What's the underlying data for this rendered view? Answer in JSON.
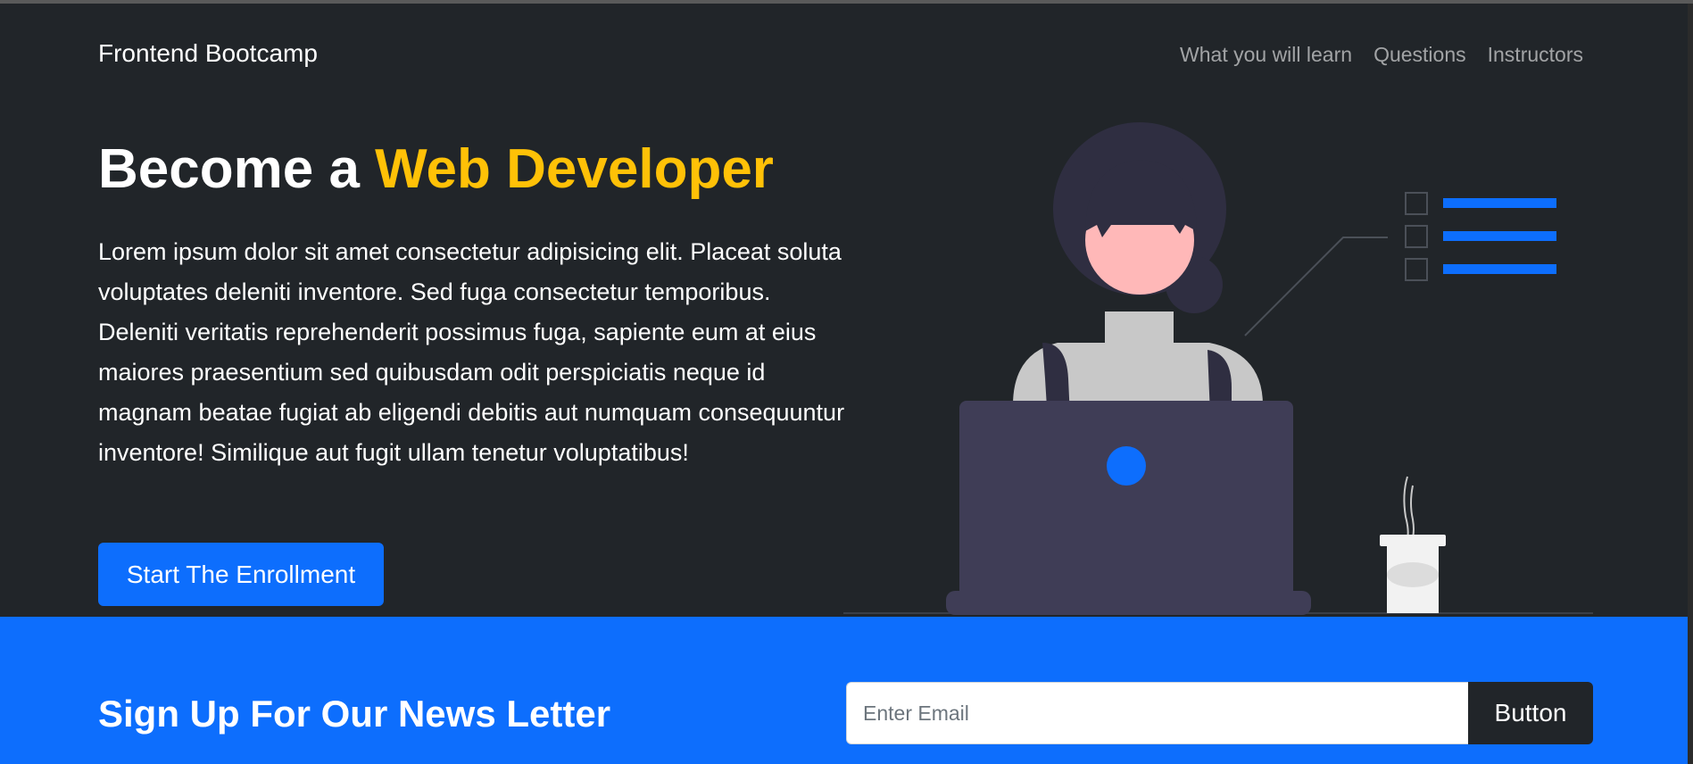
{
  "navbar": {
    "brand": "Frontend Bootcamp",
    "links": [
      "What you will learn",
      "Questions",
      "Instructors"
    ]
  },
  "hero": {
    "headline_prefix": "Become a ",
    "headline_accent": "Web Developer",
    "paragraph": "Lorem ipsum dolor sit amet consectetur adipisicing elit. Placeat soluta voluptates deleniti inventore. Sed fuga consectetur temporibus. Deleniti veritatis reprehenderit possimus fuga, sapiente eum at eius maiores praesentium sed quibusdam odit perspiciatis neque id magnam beatae fugiat ab eligendi debitis aut numquam consequuntur inventore! Similique aut fugit ullam tenetur voluptatibus!",
    "cta_label": "Start The Enrollment"
  },
  "newsletter": {
    "title": "Sign Up For Our News Letter",
    "email_placeholder": "Enter Email",
    "button_label": "Button"
  },
  "colors": {
    "dark_bg": "#212529",
    "primary": "#0d6efd",
    "accent": "#ffc107"
  },
  "icons": [
    "person-with-laptop-illustration",
    "checklist-icon",
    "coffee-cup-icon"
  ]
}
